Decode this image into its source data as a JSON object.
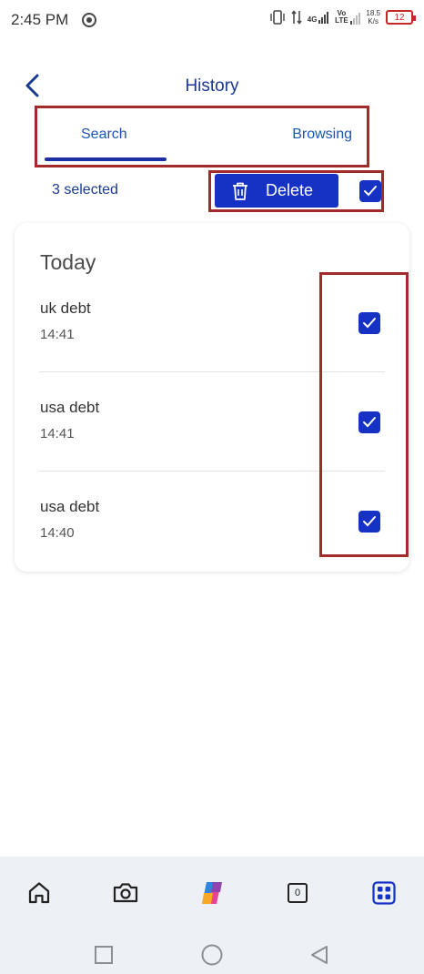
{
  "status_bar": {
    "time": "2:45 PM",
    "net_4g": "4G",
    "net_volte": "Vo LTE",
    "speed_value": "18.5",
    "speed_unit": "K/s",
    "battery": "12"
  },
  "header": {
    "title": "History",
    "back_icon": "chevron-left-icon"
  },
  "tabs": [
    {
      "label": "Search",
      "active": true
    },
    {
      "label": "Browsing",
      "active": false
    }
  ],
  "selection": {
    "count_text": "3 selected",
    "delete_label": "Delete",
    "delete_icon": "trash-icon",
    "select_all_checked": true
  },
  "history": {
    "section_title": "Today",
    "items": [
      {
        "query": "uk debt",
        "time": "14:41",
        "checked": true
      },
      {
        "query": "usa debt",
        "time": "14:41",
        "checked": true
      },
      {
        "query": "usa debt",
        "time": "14:40",
        "checked": true
      }
    ]
  },
  "bottom_nav": {
    "items": [
      "home-icon",
      "camera-icon",
      "copilot-icon",
      "tabs-icon",
      "apps-icon"
    ],
    "tabs_count": "0"
  },
  "system_nav": [
    "recents-icon",
    "home-circle-icon",
    "back-triangle-icon"
  ],
  "colors": {
    "accent": "#1532c4",
    "title": "#1a3a8f",
    "highlight_box": "#a32a2a",
    "nav_background": "#edf0f4"
  }
}
